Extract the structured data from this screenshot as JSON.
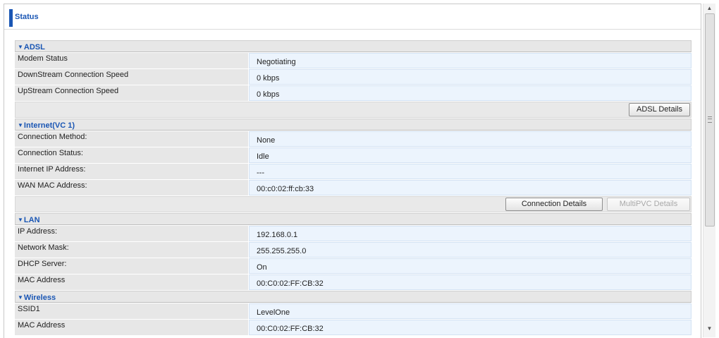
{
  "page": {
    "title": "Status"
  },
  "sections": {
    "adsl": {
      "header": "ADSL",
      "rows": [
        {
          "label": "Modem Status",
          "value": "Negotiating"
        },
        {
          "label": "DownStream Connection Speed",
          "value": "0 kbps"
        },
        {
          "label": "UpStream Connection Speed",
          "value": "0 kbps"
        }
      ],
      "buttons": {
        "details": "ADSL Details"
      }
    },
    "internet": {
      "header": "Internet(VC 1)",
      "rows": [
        {
          "label": "Connection Method:",
          "value": "None"
        },
        {
          "label": "Connection Status:",
          "value": "Idle"
        },
        {
          "label": "Internet IP Address:",
          "value": "---"
        },
        {
          "label": "WAN MAC Address:",
          "value": "00:c0:02:ff:cb:33"
        }
      ],
      "buttons": {
        "connection_details": "Connection Details",
        "multipvc_details": "MultiPVC Details"
      }
    },
    "lan": {
      "header": "LAN",
      "rows": [
        {
          "label": "IP Address:",
          "value": "192.168.0.1"
        },
        {
          "label": "Network Mask:",
          "value": "255.255.255.0"
        },
        {
          "label": "DHCP Server:",
          "value": "On"
        },
        {
          "label": "MAC Address",
          "value": "00:C0:02:FF:CB:32"
        }
      ]
    },
    "wireless": {
      "header": "Wireless",
      "rows": [
        {
          "label": "SSID1",
          "value": "LevelOne"
        },
        {
          "label": "MAC Address",
          "value": "00:C0:02:FF:CB:32"
        }
      ]
    }
  },
  "icons": {
    "section_toggle": "triangle-down-icon",
    "scroll_up": "arrow-up-icon",
    "scroll_down": "arrow-down-icon"
  },
  "colors": {
    "accent": "#1a56b4",
    "value_bg": "#ecf4fd",
    "label_bg": "#e7e7e7"
  }
}
